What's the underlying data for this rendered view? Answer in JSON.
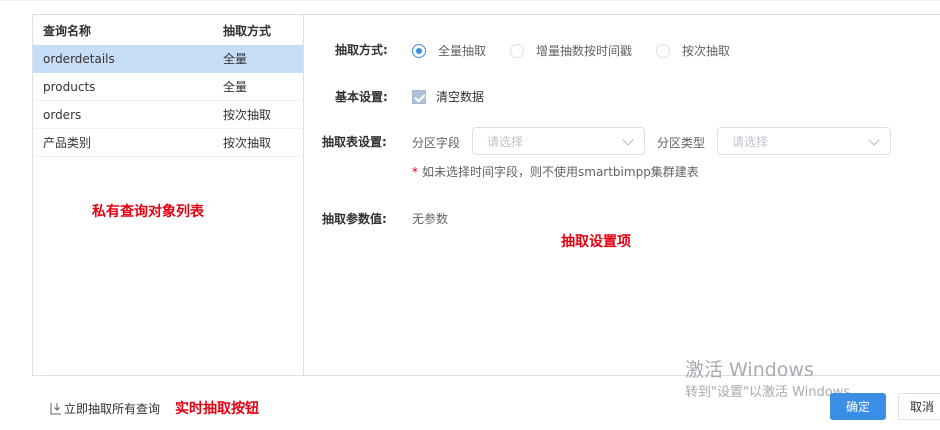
{
  "left_panel": {
    "headers": {
      "name": "查询名称",
      "method": "抽取方式"
    },
    "rows": [
      {
        "name": "orderdetails",
        "method": "全量"
      },
      {
        "name": "products",
        "method": "全量"
      },
      {
        "name": "orders",
        "method": "按次抽取"
      },
      {
        "name": "产品类别",
        "method": "按次抽取"
      }
    ],
    "annotation": "私有查询对象列表"
  },
  "right_panel": {
    "extract_mode": {
      "label": "抽取方式:",
      "options": [
        "全量抽取",
        "增量抽数按时间戳",
        "按次抽取"
      ]
    },
    "basic": {
      "label": "基本设置:",
      "checkbox_label": "清空数据"
    },
    "table_settings": {
      "label": "抽取表设置:",
      "partition_field_label": "分区字段",
      "partition_field_placeholder": "请选择",
      "partition_type_label": "分区类型",
      "partition_type_placeholder": "请选择",
      "hint_star": "*",
      "hint": "如未选择时间字段，则不使用smartbimpp集群建表"
    },
    "params": {
      "label": "抽取参数值:",
      "value": "无参数"
    },
    "annotation": "抽取设置项"
  },
  "watermark": {
    "line1": "激活 Windows",
    "line2": "转到\"设置\"以激活 Windows"
  },
  "footer": {
    "extract_all_label": "立即抽取所有查询",
    "annotation": "实时抽取按钮",
    "ok_label": "确定",
    "cancel_label": "取消"
  },
  "colors": {
    "accent": "#3a8ee6",
    "selected_row": "#c6ddf6",
    "annotation_red": "#e60012"
  }
}
